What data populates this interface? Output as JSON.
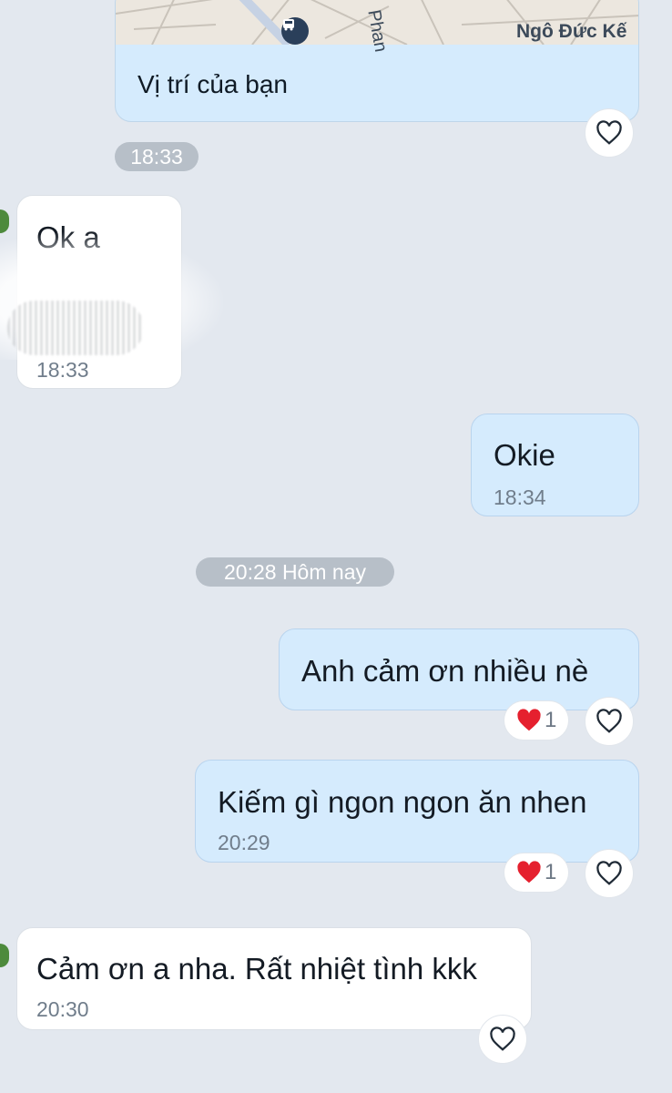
{
  "location_card": {
    "street_name": "Ngô Đức Kế",
    "street_partial": "Phan",
    "label": "Vị trí của bạn"
  },
  "timestamps": {
    "divider_1": "18:33",
    "divider_2": "20:28 Hôm nay"
  },
  "messages": [
    {
      "side": "received",
      "text": "Ok a",
      "time": "18:33"
    },
    {
      "side": "sent",
      "text": "Okie",
      "time": "18:34"
    },
    {
      "side": "sent",
      "text": "Anh cảm ơn nhiều nè",
      "time": "",
      "reaction": "1"
    },
    {
      "side": "sent",
      "text": "Kiếm gì ngon ngon ăn nhen",
      "time": "20:29",
      "reaction": "1"
    },
    {
      "side": "received",
      "text": "Cảm ơn a nha. Rất nhiệt tình kkk",
      "time": "20:30"
    }
  ],
  "icons": {
    "like": "heart-outline-icon",
    "reaction": "red-heart-icon",
    "map_poi": "bus-stop-icon"
  },
  "colors": {
    "background": "#e3e8ef",
    "sent_bubble": "#d5ebfd",
    "received_bubble": "#ffffff",
    "heart_red": "#e5202e",
    "time_gray": "#707d8b"
  }
}
